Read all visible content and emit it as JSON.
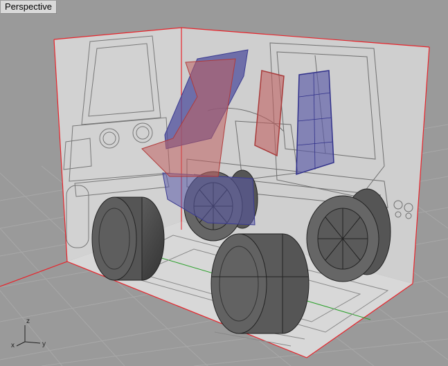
{
  "viewport": {
    "name": "Perspective"
  },
  "axes": {
    "x": "x",
    "y": "y",
    "z": "z"
  },
  "colors": {
    "background": "#9a9a9a",
    "grid": "#a6a6a6",
    "plane": "#d0d0d0",
    "plane_edge": "#e8242b",
    "surface_blue": "#5a5aa8",
    "surface_red": "#c06060",
    "tire": "#4a4a4a"
  },
  "icons": {
    "axis_gizmo": "xyz-axis-icon"
  }
}
